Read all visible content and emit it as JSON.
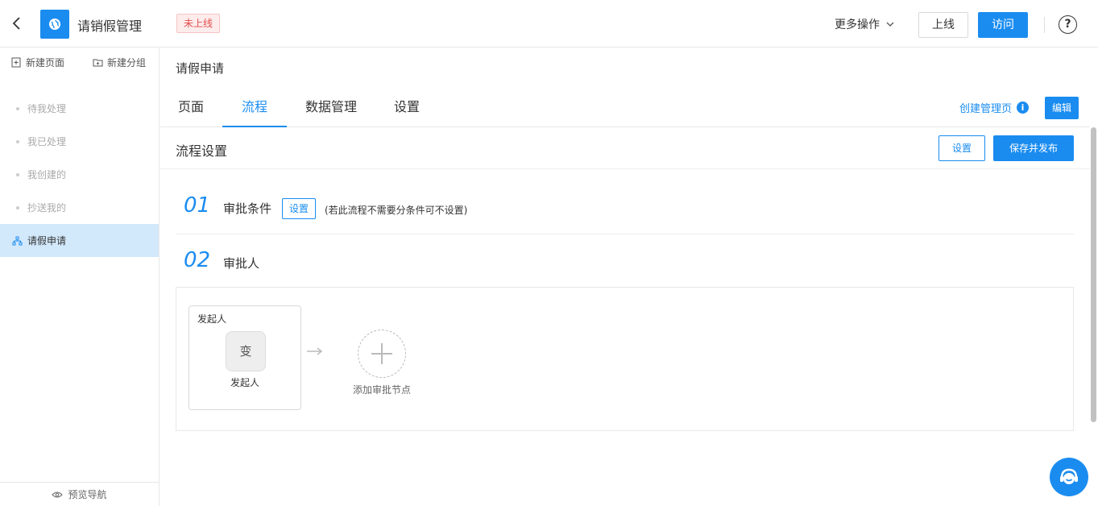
{
  "header": {
    "app_title": "请销假管理",
    "status_badge": "未上线",
    "more_ops": "更多操作",
    "online_label": "上线",
    "visit_label": "访问",
    "help_glyph": "?"
  },
  "sidebar": {
    "new_page": "新建页面",
    "new_group": "新建分组",
    "items": [
      {
        "label": "待我处理"
      },
      {
        "label": "我已处理"
      },
      {
        "label": "我创建的"
      },
      {
        "label": "抄送我的"
      },
      {
        "label": "请假申请",
        "active": true
      }
    ],
    "footer": "预览导航"
  },
  "main": {
    "page_name": "请假申请",
    "tabs": [
      {
        "label": "页面"
      },
      {
        "label": "流程",
        "active": true
      },
      {
        "label": "数据管理"
      },
      {
        "label": "设置"
      }
    ],
    "create_manage": "创建管理页",
    "edit_label": "编辑"
  },
  "flow": {
    "title": "流程设置",
    "settings_label": "设置",
    "save_publish_label": "保存并发布",
    "step1": {
      "num": "01",
      "label": "审批条件",
      "set_label": "设置",
      "note": "(若此流程不需要分条件可不设置)"
    },
    "step2": {
      "num": "02",
      "label": "审批人"
    },
    "initiator_node": {
      "title": "发起人",
      "avatar_text": "变",
      "label": "发起人"
    },
    "add_node_label": "添加审批节点"
  },
  "colors": {
    "accent": "#1a8cf0",
    "badge_red": "#e34d4d",
    "active_bg": "#d2e8fb"
  }
}
